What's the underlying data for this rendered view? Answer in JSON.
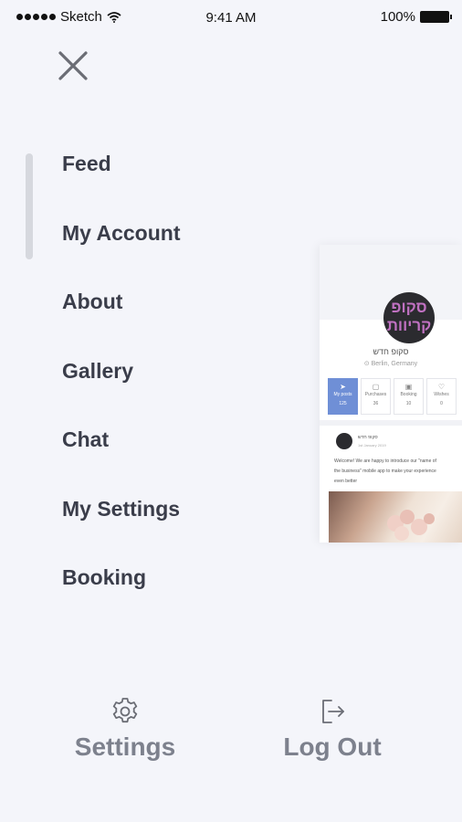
{
  "status_bar": {
    "carrier": "Sketch",
    "time": "9:41 AM",
    "battery": "100%"
  },
  "menu": {
    "items": [
      {
        "label": "Feed"
      },
      {
        "label": "My Account"
      },
      {
        "label": "About"
      },
      {
        "label": "Gallery"
      },
      {
        "label": "Chat"
      },
      {
        "label": "My Settings"
      },
      {
        "label": "Booking"
      }
    ]
  },
  "preview": {
    "avatar_text_1": "סקופ",
    "avatar_text_2": "קריוות",
    "name": "סקופ חדש",
    "location": "Berlin, Germany",
    "stats": [
      {
        "label": "My posts",
        "value": "125"
      },
      {
        "label": "Purchases",
        "value": "36"
      },
      {
        "label": "Booking",
        "value": "10"
      },
      {
        "label": "Wishes",
        "value": "0"
      }
    ],
    "post": {
      "author": "סקופ חדש",
      "date": "1st January 2019",
      "text_line_1": "Welcome! We are happy to introduce our \"name of",
      "text_line_2": "the business\" mobile app to make your experience",
      "text_line_3": "even better"
    }
  },
  "bottom": {
    "settings_label": "Settings",
    "logout_label": "Log Out"
  },
  "colors": {
    "background": "#f4f5fa",
    "menu_text": "#3a3d4a",
    "bottom_text": "#7d818d",
    "accent": "#6f8fd6"
  }
}
